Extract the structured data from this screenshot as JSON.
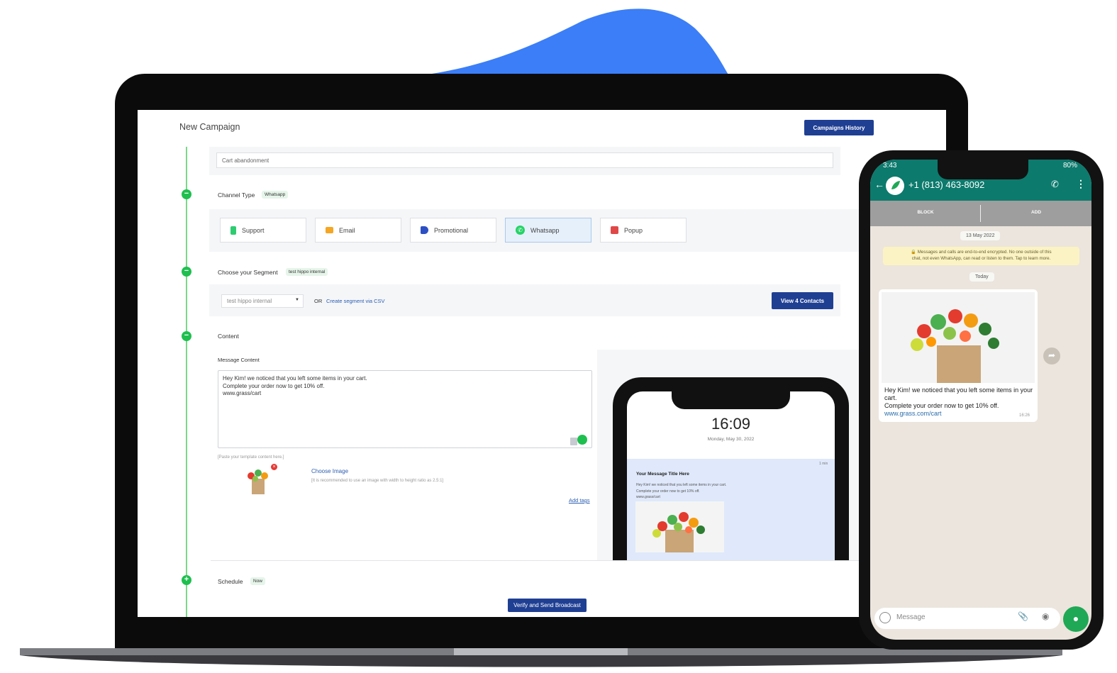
{
  "campaign": {
    "title": "New Campaign",
    "history_button": "Campaigns History",
    "campaign_name_value": "Cart abandonment",
    "channel_type": {
      "label": "Channel Type",
      "selected_tag": "Whatsapp",
      "options": [
        {
          "label": "Support",
          "icon": "phone-icon",
          "color": "#2ecc71",
          "selected": false
        },
        {
          "label": "Email",
          "icon": "email-icon",
          "color": "#f5a623",
          "selected": false
        },
        {
          "label": "Promotional",
          "icon": "megaphone-icon",
          "color": "#2d4fc4",
          "selected": false
        },
        {
          "label": "Whatsapp",
          "icon": "whatsapp-icon",
          "color": "#25d366",
          "selected": true
        },
        {
          "label": "Popup",
          "icon": "popup-icon",
          "color": "#e04848",
          "selected": false
        }
      ]
    },
    "segment": {
      "label": "Choose your Segment",
      "selected_tag": "test hippo internal",
      "dropdown_value": "test hippo internal",
      "or_text": "OR",
      "csv_link": "Create segment via CSV",
      "view_contacts_button": "View 4 Contacts"
    },
    "content": {
      "label": "Content",
      "message_label": "Message Content",
      "message_lines": [
        "Hey Kim! we noticed that you left some items in your cart.",
        "Complete your order now to get 10% off.",
        "www.grass/cart"
      ],
      "paste_hint": "[Paste your template content here.]",
      "choose_image": "Choose Image",
      "image_hint": "[It is recommended to use an image with width to height ratio as 2.5:1]",
      "add_tags": "Add tags"
    },
    "preview": {
      "time": "16:09",
      "date": "Monday, May 30, 2022",
      "notif_time": "1 min",
      "notif_title": "Your Message Title Here",
      "notif_lines": [
        "Hey Kim! we noticed that you left some items in your cart.",
        "Complete your order now to get 10% off.",
        "www.grass/cart"
      ]
    },
    "schedule": {
      "label": "Schedule",
      "tag": "Now",
      "send_button": "Verify and Send Broadcast"
    }
  },
  "whatsapp": {
    "status_time": "3:43",
    "status_battery": "80%",
    "contact": "+1 (813) 463-8092",
    "actions": [
      "BLOCK",
      "ADD"
    ],
    "date_pill": "13 May 2022",
    "encryption_line1": "🔒 Messages and calls are end-to-end encrypted. No one outside of this",
    "encryption_line2": "chat, not even WhatsApp, can read or listen to them. Tap to learn more.",
    "today_pill": "Today",
    "message_line1": "Hey Kim! we noticed that you left some items in your cart.",
    "message_line2": "Complete your order now to get 10% off.",
    "message_url": "www.grass.com/cart",
    "message_time": "16:26",
    "input_placeholder": "Message"
  },
  "colors": {
    "brand_blue": "#1f3f93",
    "accent_green": "#1fbf4f",
    "wa_teal": "#0c7a6d",
    "blob_blue": "#3b7ef7"
  }
}
